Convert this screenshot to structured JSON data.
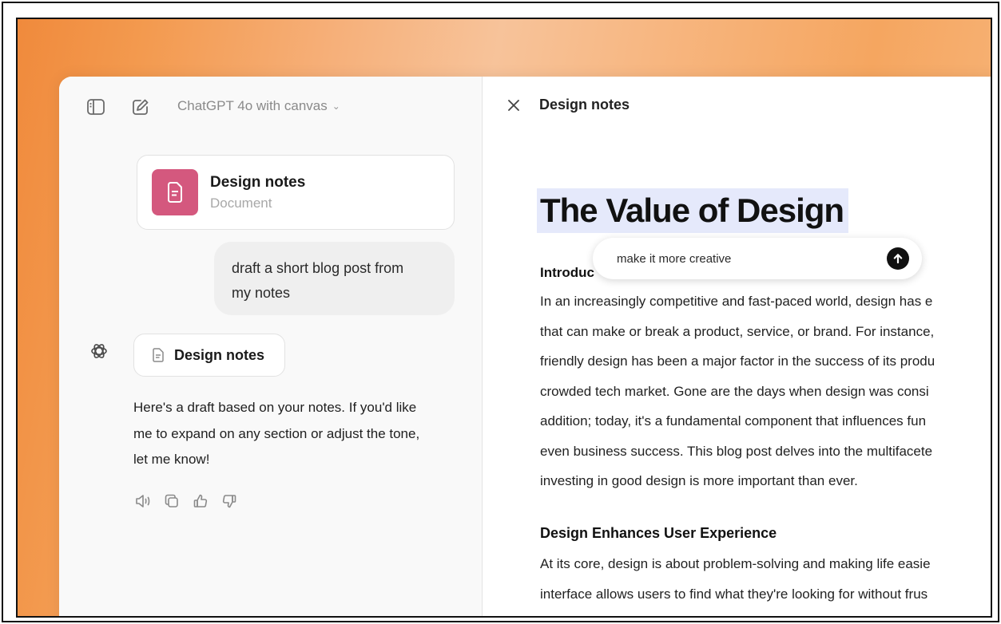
{
  "colors": {
    "background_gradient": [
      "#f08a3c",
      "#f7c39a",
      "#f5a660"
    ],
    "doc_tile": "#d4587e",
    "title_highlight": "#e5e9fb"
  },
  "sidebar_header": {
    "toggle_icon": "sidebar-toggle-icon",
    "new_chat_icon": "edit-icon",
    "model_label": "ChatGPT 4o with canvas"
  },
  "conversation": {
    "doc_card": {
      "title": "Design notes",
      "subtitle": "Document",
      "icon": "document-icon"
    },
    "user_message": [
      "draft a short blog post from",
      "my notes"
    ],
    "assistant_chip": {
      "label": "Design notes",
      "icon": "document-icon"
    },
    "assistant_reply": [
      "Here's a draft based on your notes. If you'd like",
      "me to expand on any section or adjust the tone,",
      "let me know!"
    ],
    "actions": [
      "speaker-icon",
      "copy-icon",
      "thumbs-up-icon",
      "thumbs-down-icon"
    ]
  },
  "canvas": {
    "title": "Design notes",
    "doc_heading": "The Value of Design",
    "prompt": "make it more creative",
    "section1_heading": "Introduc",
    "section1_lines": [
      "In an increasingly competitive and fast-paced world, design has e",
      "that can make or break a product, service, or brand. For instance,",
      "friendly design has been a major factor in the success of its produ",
      "crowded tech market. Gone are the days when design was consi",
      "addition; today, it's a fundamental component that influences fun",
      "even business success. This blog post delves into the multifacete",
      "investing in good design is more important than ever."
    ],
    "section2_heading": "Design Enhances User Experience",
    "section2_lines": [
      "At its core, design is about problem-solving and making life easie",
      "interface allows users to find what they're looking for without frus"
    ]
  }
}
